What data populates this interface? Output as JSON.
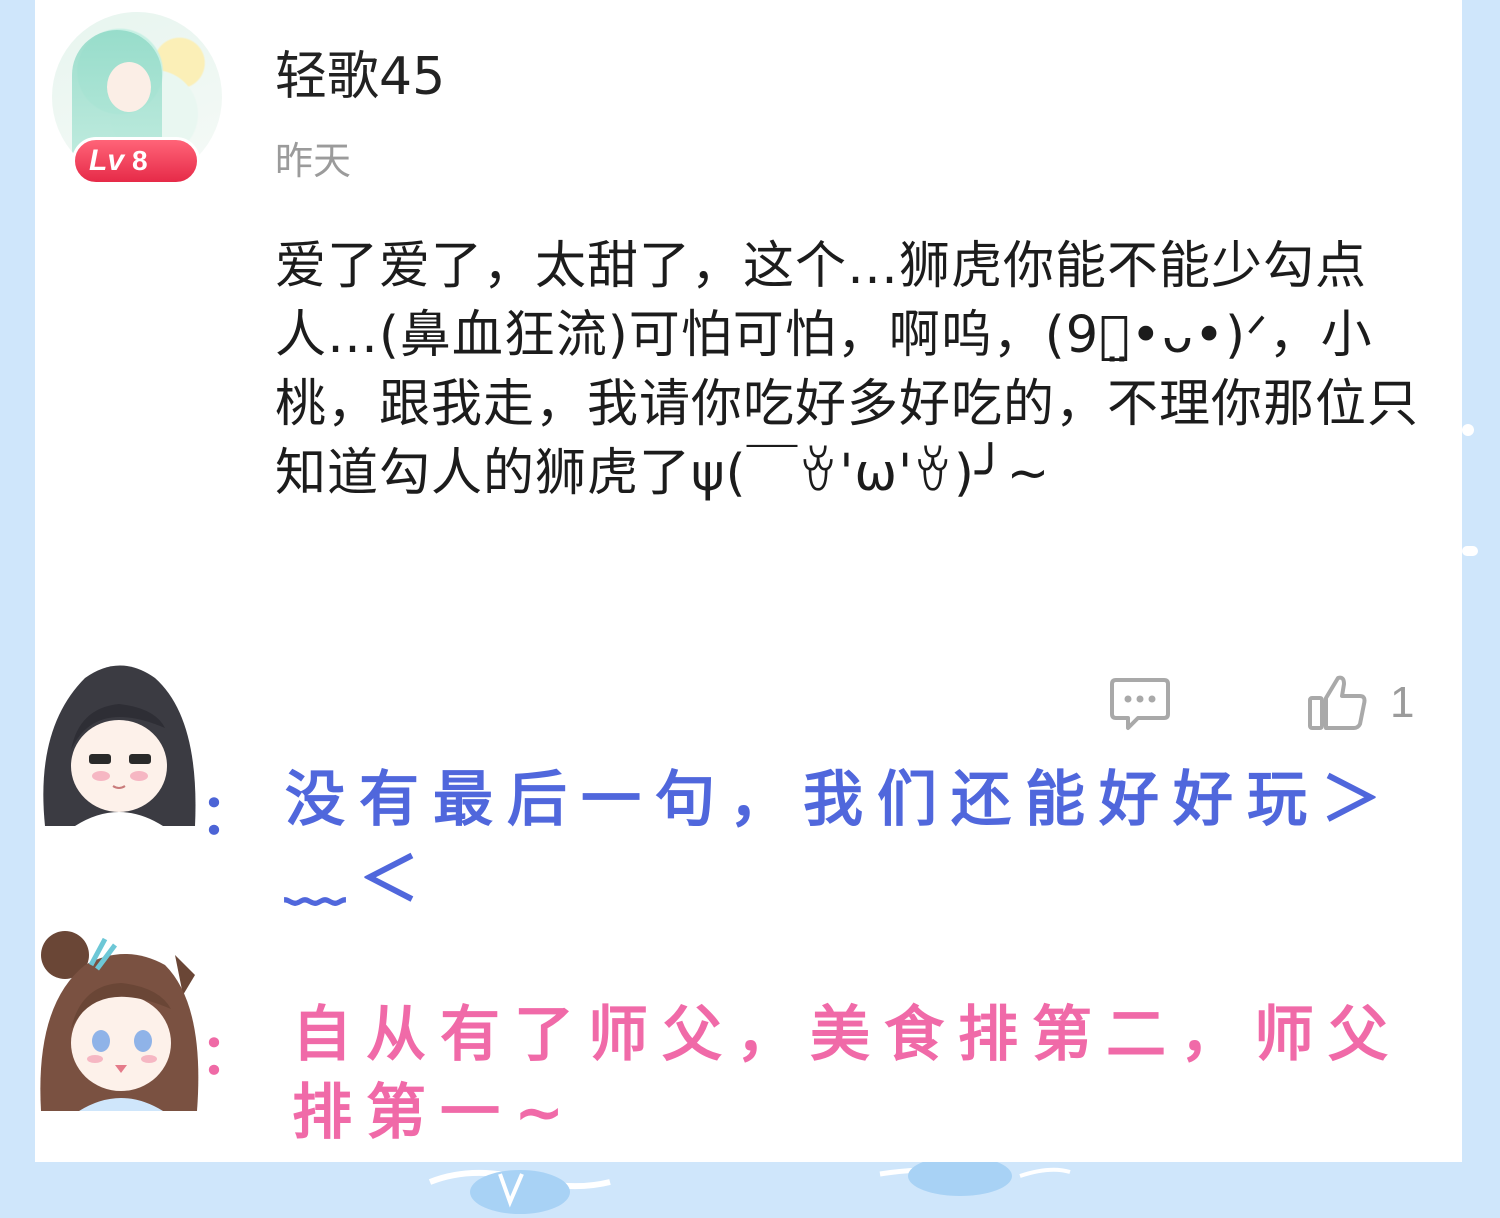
{
  "comment": {
    "username": "轻歌45",
    "level_badge": {
      "prefix": "Lv",
      "number": "8"
    },
    "timestamp": "昨天",
    "text": "爱了爱了，太甜了，这个…狮虎你能不能少勾点人…(鼻血狂流)可怕可怕，啊呜，(9ৎ̤•ᴗ•)ᐟ，小桃，跟我走，我请你吃好多好吃的，不理你那位只知道勾人的狮虎了ψ(￣ꈊ'ω'ꈊ)╯~"
  },
  "actions": {
    "reply_icon": "comment-bubble-icon",
    "like_icon": "thumbs-up-icon",
    "like_count": "1"
  },
  "overlay_notes": [
    {
      "speaker": "dark-haired-chibi-girl",
      "colon": "：",
      "text": "没有最后一句，我们还能好好玩＞﹏＜",
      "color": "#5067dc"
    },
    {
      "speaker": "brown-haired-chibi-girl",
      "colon": "：",
      "text": "自从有了师父，美食排第二，师父排第一~",
      "color": "#f06aa8"
    }
  ],
  "colors": {
    "background": "#cfe6fb",
    "card": "#ffffff",
    "badge_red": "#e62a48",
    "muted_gray": "#9b9b9b"
  }
}
